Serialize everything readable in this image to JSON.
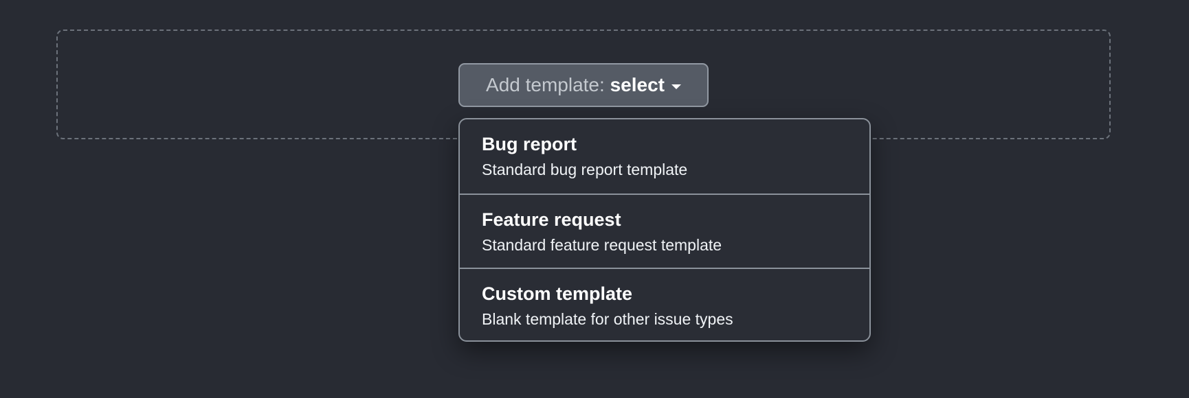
{
  "template_selector": {
    "button": {
      "prefix": "Add template: ",
      "value": "select",
      "caret_icon": "chevron-down-icon"
    },
    "menu": {
      "items": [
        {
          "title": "Bug report",
          "description": "Standard bug report template"
        },
        {
          "title": "Feature request",
          "description": "Standard feature request template"
        },
        {
          "title": "Custom template",
          "description": "Blank template for other issue types"
        }
      ]
    }
  },
  "colors": {
    "background": "#282b33",
    "button_background": "#555b65",
    "menu_background": "#2a2d35",
    "border": "#8b929b"
  }
}
